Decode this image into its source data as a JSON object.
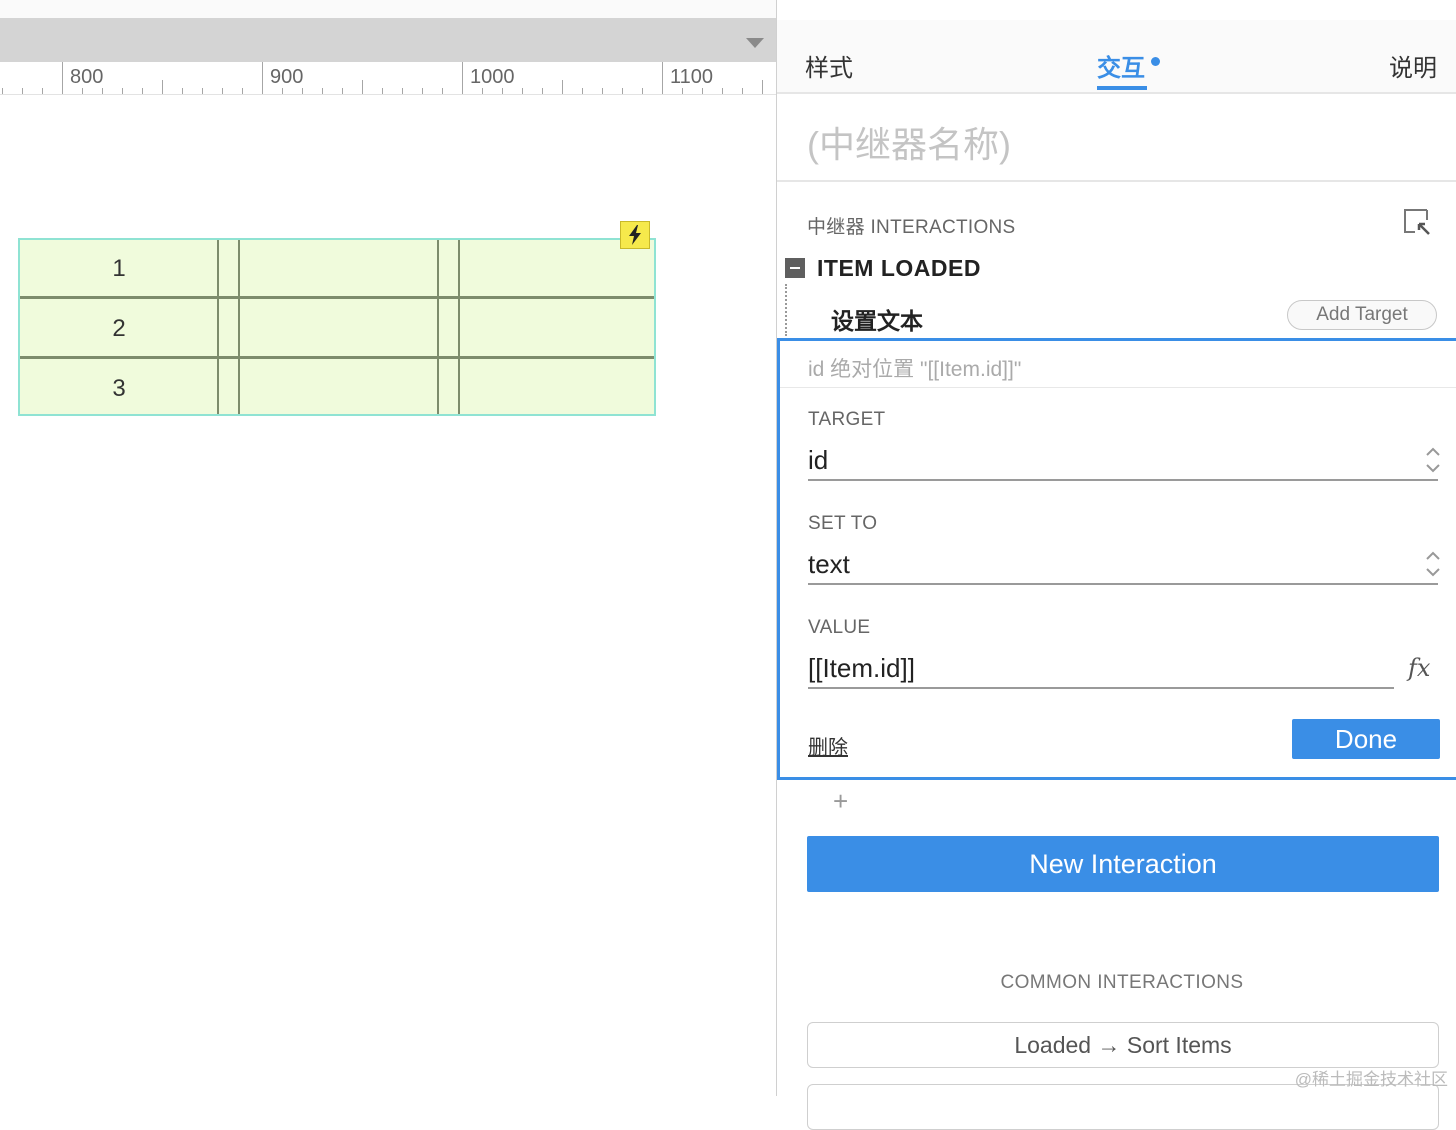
{
  "ruler": {
    "labels": [
      "800",
      "900",
      "1000",
      "1100"
    ]
  },
  "repeater": {
    "rows": [
      "1",
      "2",
      "3"
    ]
  },
  "panel": {
    "tabs": [
      "样式",
      "交互",
      "说明"
    ],
    "active_tab": "交互",
    "widget_name_placeholder": "(中继器名称)",
    "interactions_title": "中继器 INTERACTIONS",
    "event": "ITEM LOADED",
    "action": "设置文本",
    "add_target": "Add Target",
    "editor": {
      "summary": "id 绝对位置 \"[[Item.id]]\"",
      "target_label": "TARGET",
      "target_value": "id",
      "set_to_label": "SET TO",
      "set_to_value": "text",
      "value_label": "VALUE",
      "value_value": "[[Item.id]]",
      "delete": "删除",
      "done": "Done"
    },
    "add_symbol": "+",
    "new_interaction": "New Interaction",
    "common_title": "COMMON INTERACTIONS",
    "common_items": [
      "Loaded → Sort Items"
    ]
  },
  "watermark": "@稀土掘金技术社区",
  "colors": {
    "accent": "#3a8ee6",
    "repeater_fill": "#f0fbdc",
    "repeater_border": "#8fe3d3"
  },
  "icons": [
    "dropdown-arrow-icon",
    "lightning-icon",
    "collapse-icon",
    "external-link-icon",
    "stepper-icon",
    "fx-icon",
    "plus-icon"
  ]
}
